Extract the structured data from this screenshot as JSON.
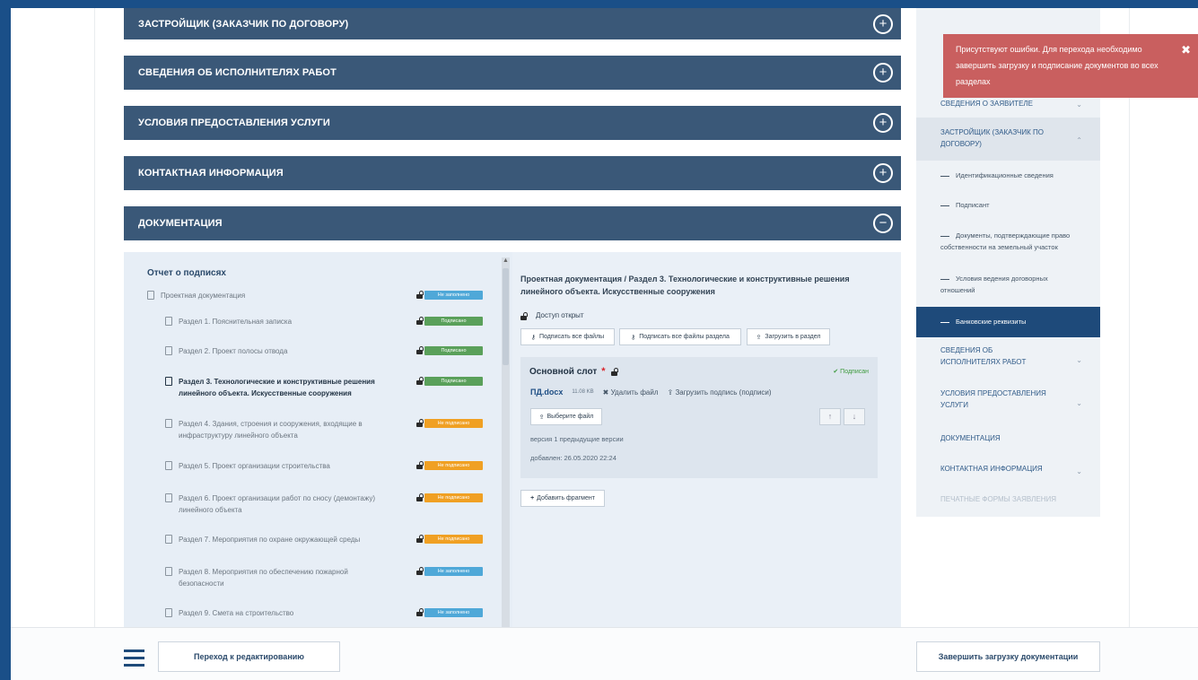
{
  "accordion": [
    {
      "label": "ЗАСТРОЙЩИК (ЗАКАЗЧИК ПО ДОГОВОРУ)",
      "toggle": "+"
    },
    {
      "label": "СВЕДЕНИЯ ОБ ИСПОЛНИТЕЛЯХ РАБОТ",
      "toggle": "+"
    },
    {
      "label": "УСЛОВИЯ ПРЕДОСТАВЛЕНИЯ УСЛУГИ",
      "toggle": "+"
    },
    {
      "label": "КОНТАКТНАЯ ИНФОРМАЦИЯ",
      "toggle": "+"
    },
    {
      "label": "ДОКУМЕНТАЦИЯ",
      "toggle": "−"
    }
  ],
  "report": {
    "title": "Отчет о подписях",
    "root": {
      "label": "Проектная документация",
      "status": "Не заполнено"
    },
    "sections": [
      {
        "label": "Раздел 1. Пояснительная записка",
        "status": "Подписано",
        "color": "#5aa05a"
      },
      {
        "label": "Раздел 2. Проект полосы отвода",
        "status": "Подписано",
        "color": "#5aa05a"
      },
      {
        "label": "Раздел 3. Технологические и конструктивные решения линейного объекта. Искусственные сооружения",
        "status": "Подписано",
        "color": "#5aa05a",
        "bold": true
      },
      {
        "label": "Раздел 4. Здания, строения и сооружения, входящие в инфраструктуру линейного объекта",
        "status": "Не подписано",
        "color": "#f0a023"
      },
      {
        "label": "Раздел 5. Проект организации строительства",
        "status": "Не подписано",
        "color": "#f0a023"
      },
      {
        "label": "Раздел 6. Проект организации работ по сносу (демонтажу) линейного объекта",
        "status": "Не подписано",
        "color": "#f0a023"
      },
      {
        "label": "Раздел 7. Мероприятия по охране окружающей среды",
        "status": "Не подписано",
        "color": "#f0a023"
      },
      {
        "label": "Раздел 8. Мероприятия по обеспечению пожарной безопасности",
        "status": "Не заполнено",
        "color": "#4fa8d8"
      },
      {
        "label": "Раздел 9. Смета на строительство",
        "status": "Не заполнено",
        "color": "#4fa8d8"
      }
    ]
  },
  "detail": {
    "title": "Проектная документация / Раздел 3. Технологические и конструктивные решения линейного объекта. Искусственные сооружения",
    "access": "Доступ открыт",
    "buttons": {
      "sign_all_files": "Подписать все файлы",
      "sign_section_files": "Подписать все файлы раздела",
      "upload_to_section": "Загрузить в раздел"
    },
    "slot": {
      "title": "Основной слот",
      "status": "Подписан",
      "file_name": "ПД.docx",
      "file_size": "11.08 KB",
      "delete_label": "Удалить файл",
      "upload_signature_label": "Загрузить подпись (подписи)",
      "choose_file": "Выберите файл",
      "up_arrow": "↑",
      "down_arrow": "↓",
      "version": "версия 1  предыдущие версии",
      "added": "добавлен: 26.05.2020 22:24"
    },
    "add_fragment": "Добавить фрагмент"
  },
  "nav": {
    "items": [
      {
        "label": "СВЕДЕНИЯ О ЗАЯВИТЕЛЕ",
        "chev": "⌄"
      },
      {
        "label": "ЗАСТРОЙЩИК (ЗАКАЗЧИК ПО ДОГОВОРУ)",
        "chev": "⌃"
      },
      {
        "label": "СВЕДЕНИЯ ОБ ИСПОЛНИТЕЛЯХ РАБОТ",
        "chev": "⌄"
      },
      {
        "label": "УСЛОВИЯ ПРЕДОСТАВЛЕНИЯ УСЛУГИ",
        "chev": "⌄"
      },
      {
        "label": "ДОКУМЕНТАЦИЯ"
      },
      {
        "label": "КОНТАКТНАЯ ИНФОРМАЦИЯ",
        "chev": "⌄"
      },
      {
        "label": "ПЕЧАТНЫЕ ФОРМЫ ЗАЯВЛЕНИЯ"
      }
    ],
    "subitems": [
      {
        "label": "Идентификационные сведения"
      },
      {
        "label": "Подписант"
      },
      {
        "label": "Документы, подтверждающие право собственности на земельный участок"
      },
      {
        "label": "Условия ведения договорных отношений"
      },
      {
        "label": "Банковские реквизиты",
        "active": true
      }
    ]
  },
  "toast": {
    "message": "Присутствуют ошибки. Для перехода необходимо завершить загрузку и подписание документов во всех разделах",
    "close": "✖"
  },
  "bottom": {
    "edit_button": "Переход к редактированию",
    "finish_button": "Завершить загрузку документации"
  },
  "colors": {
    "accordion": "#3a5878",
    "signed": "#5aa05a",
    "not_signed": "#f0a023",
    "not_filled": "#4fa8d8",
    "error": "#c95f5f",
    "nav_active": "#1e4a7a"
  }
}
